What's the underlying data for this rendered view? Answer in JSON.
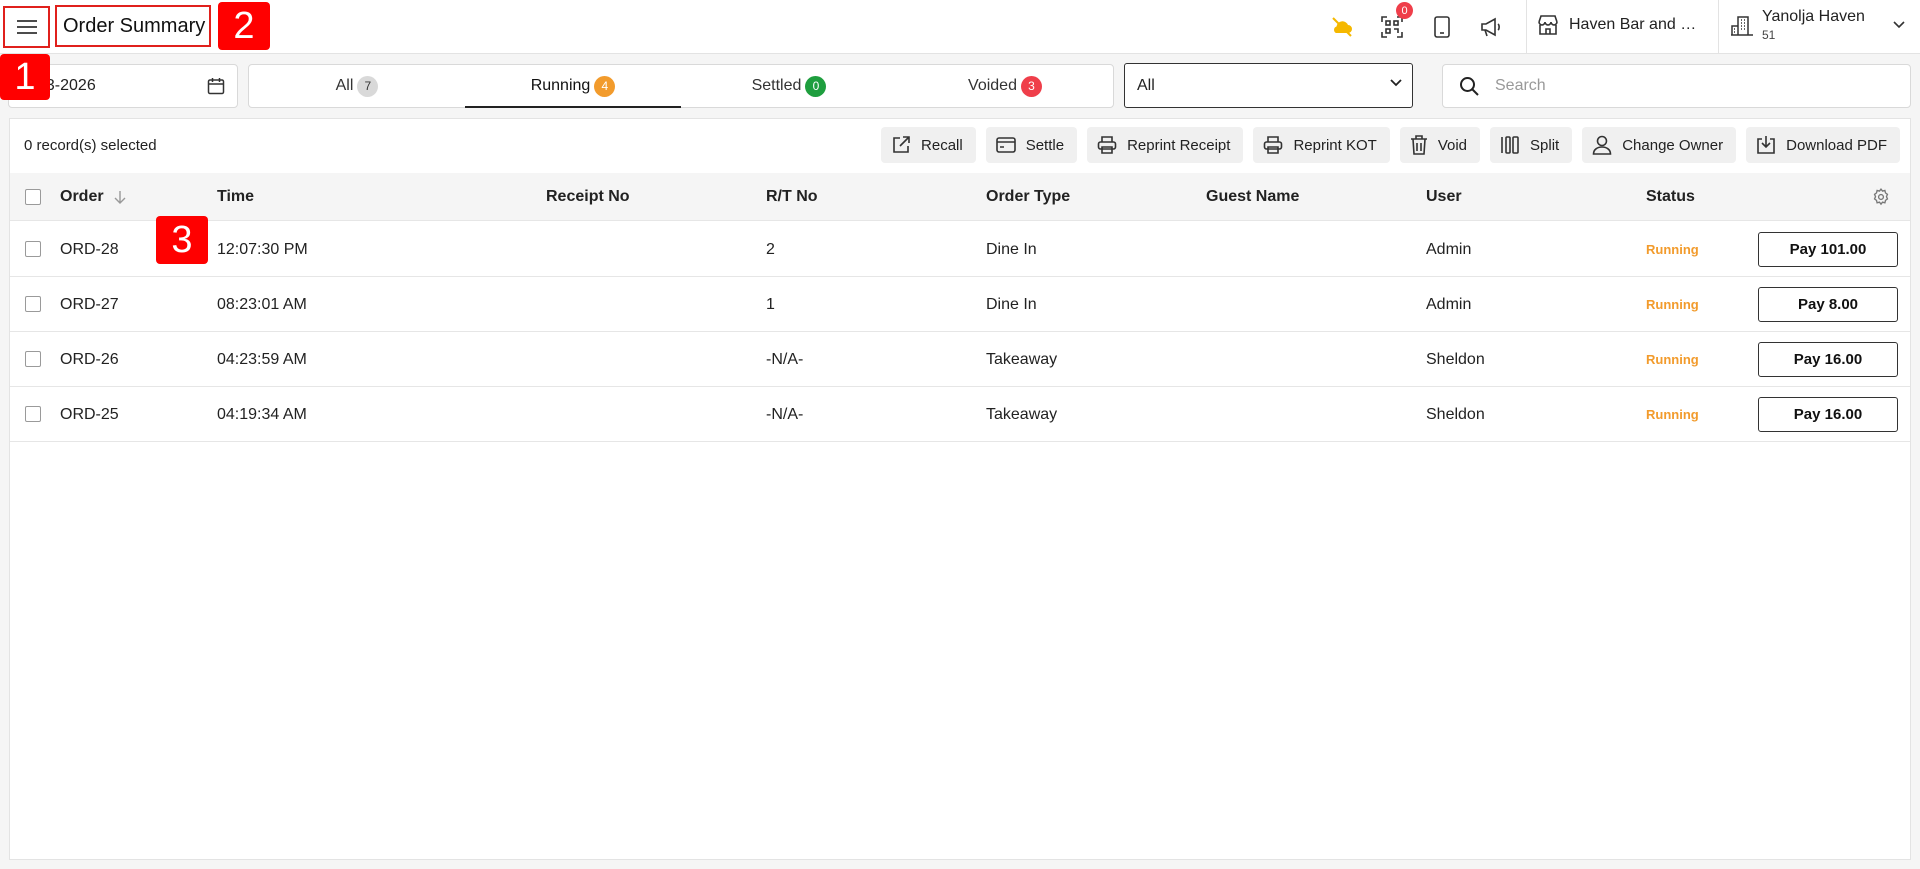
{
  "header": {
    "title": "Order Summary",
    "qr_count": "0",
    "store_name": "Haven Bar and Restaurant",
    "account_name": "Yanolja Haven",
    "account_sub": "51"
  },
  "markers": [
    "1",
    "2",
    "3"
  ],
  "filters": {
    "date": "03-2026",
    "tabs": [
      {
        "label": "All",
        "count": "7",
        "color": "#d3d3d3"
      },
      {
        "label": "Running",
        "count": "4",
        "color": "#f29b2c"
      },
      {
        "label": "Settled",
        "count": "0",
        "color": "#1e9e3e"
      },
      {
        "label": "Voided",
        "count": "3",
        "color": "#ef3e4a"
      }
    ],
    "select_value": "All",
    "search_placeholder": "Search"
  },
  "toolbar": {
    "selected": "0 record(s) selected",
    "actions": [
      "Recall",
      "Settle",
      "Reprint Receipt",
      "Reprint KOT",
      "Void",
      "Split",
      "Change Owner",
      "Download PDF"
    ]
  },
  "table": {
    "columns": [
      "Order",
      "Time",
      "Receipt No",
      "R/T No",
      "Order Type",
      "Guest Name",
      "User",
      "Status"
    ],
    "rows": [
      {
        "order": "ORD-28",
        "time": "12:07:30 PM",
        "receipt": "",
        "rt": "2",
        "type": "Dine In",
        "guest": "",
        "user": "Admin",
        "status": "Running",
        "pay": "Pay 101.00"
      },
      {
        "order": "ORD-27",
        "time": "08:23:01 AM",
        "receipt": "",
        "rt": "1",
        "type": "Dine In",
        "guest": "",
        "user": "Admin",
        "status": "Running",
        "pay": "Pay 8.00"
      },
      {
        "order": "ORD-26",
        "time": "04:23:59 AM",
        "receipt": "",
        "rt": "-N/A-",
        "type": "Takeaway",
        "guest": "",
        "user": "Sheldon",
        "status": "Running",
        "pay": "Pay 16.00"
      },
      {
        "order": "ORD-25",
        "time": "04:19:34 AM",
        "receipt": "",
        "rt": "-N/A-",
        "type": "Takeaway",
        "guest": "",
        "user": "Sheldon",
        "status": "Running",
        "pay": "Pay 16.00"
      }
    ]
  }
}
